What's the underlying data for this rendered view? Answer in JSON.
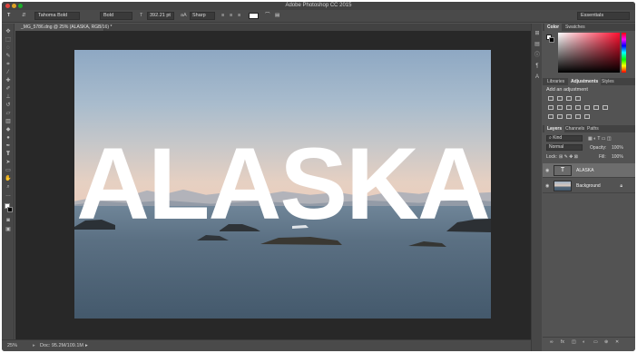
{
  "window": {
    "title": "Adobe Photoshop CC 2015"
  },
  "options_bar": {
    "tool_icon": "T",
    "font_family": "Tahoma Bold",
    "font_style": "Bold",
    "font_size": "392.21 pt",
    "aa_icon": "aA",
    "anti_alias": "Sharp",
    "workspace": "Essentials"
  },
  "document": {
    "tab_title": "_MG_5786.dng @ 25% (ALASKA, RGB/16) *",
    "text_layer_content": "ALASKA",
    "zoom": "25%",
    "doc_size": "Doc: 95.2M/109.1M"
  },
  "panels": {
    "color_tabs": [
      "Color",
      "Swatches"
    ],
    "adjust_tabs": [
      "Libraries",
      "Adjustments",
      "Styles"
    ],
    "adjust_heading": "Add an adjustment",
    "layers_tabs": [
      "Layers",
      "Channels",
      "Paths"
    ],
    "kind_filter": "Kind",
    "blend_mode": "Normal",
    "opacity_label": "Opacity:",
    "opacity_value": "100%",
    "lock_label": "Lock:",
    "fill_label": "Fill:",
    "fill_value": "100%",
    "layers": [
      {
        "name": "ALASKA",
        "type": "text",
        "thumb": "T",
        "selected": true
      },
      {
        "name": "Background",
        "type": "image",
        "selected": false
      }
    ]
  },
  "colors": {
    "accent_selected": "#6d6d6d",
    "foreground": "#ffffff",
    "background": "#000000"
  }
}
